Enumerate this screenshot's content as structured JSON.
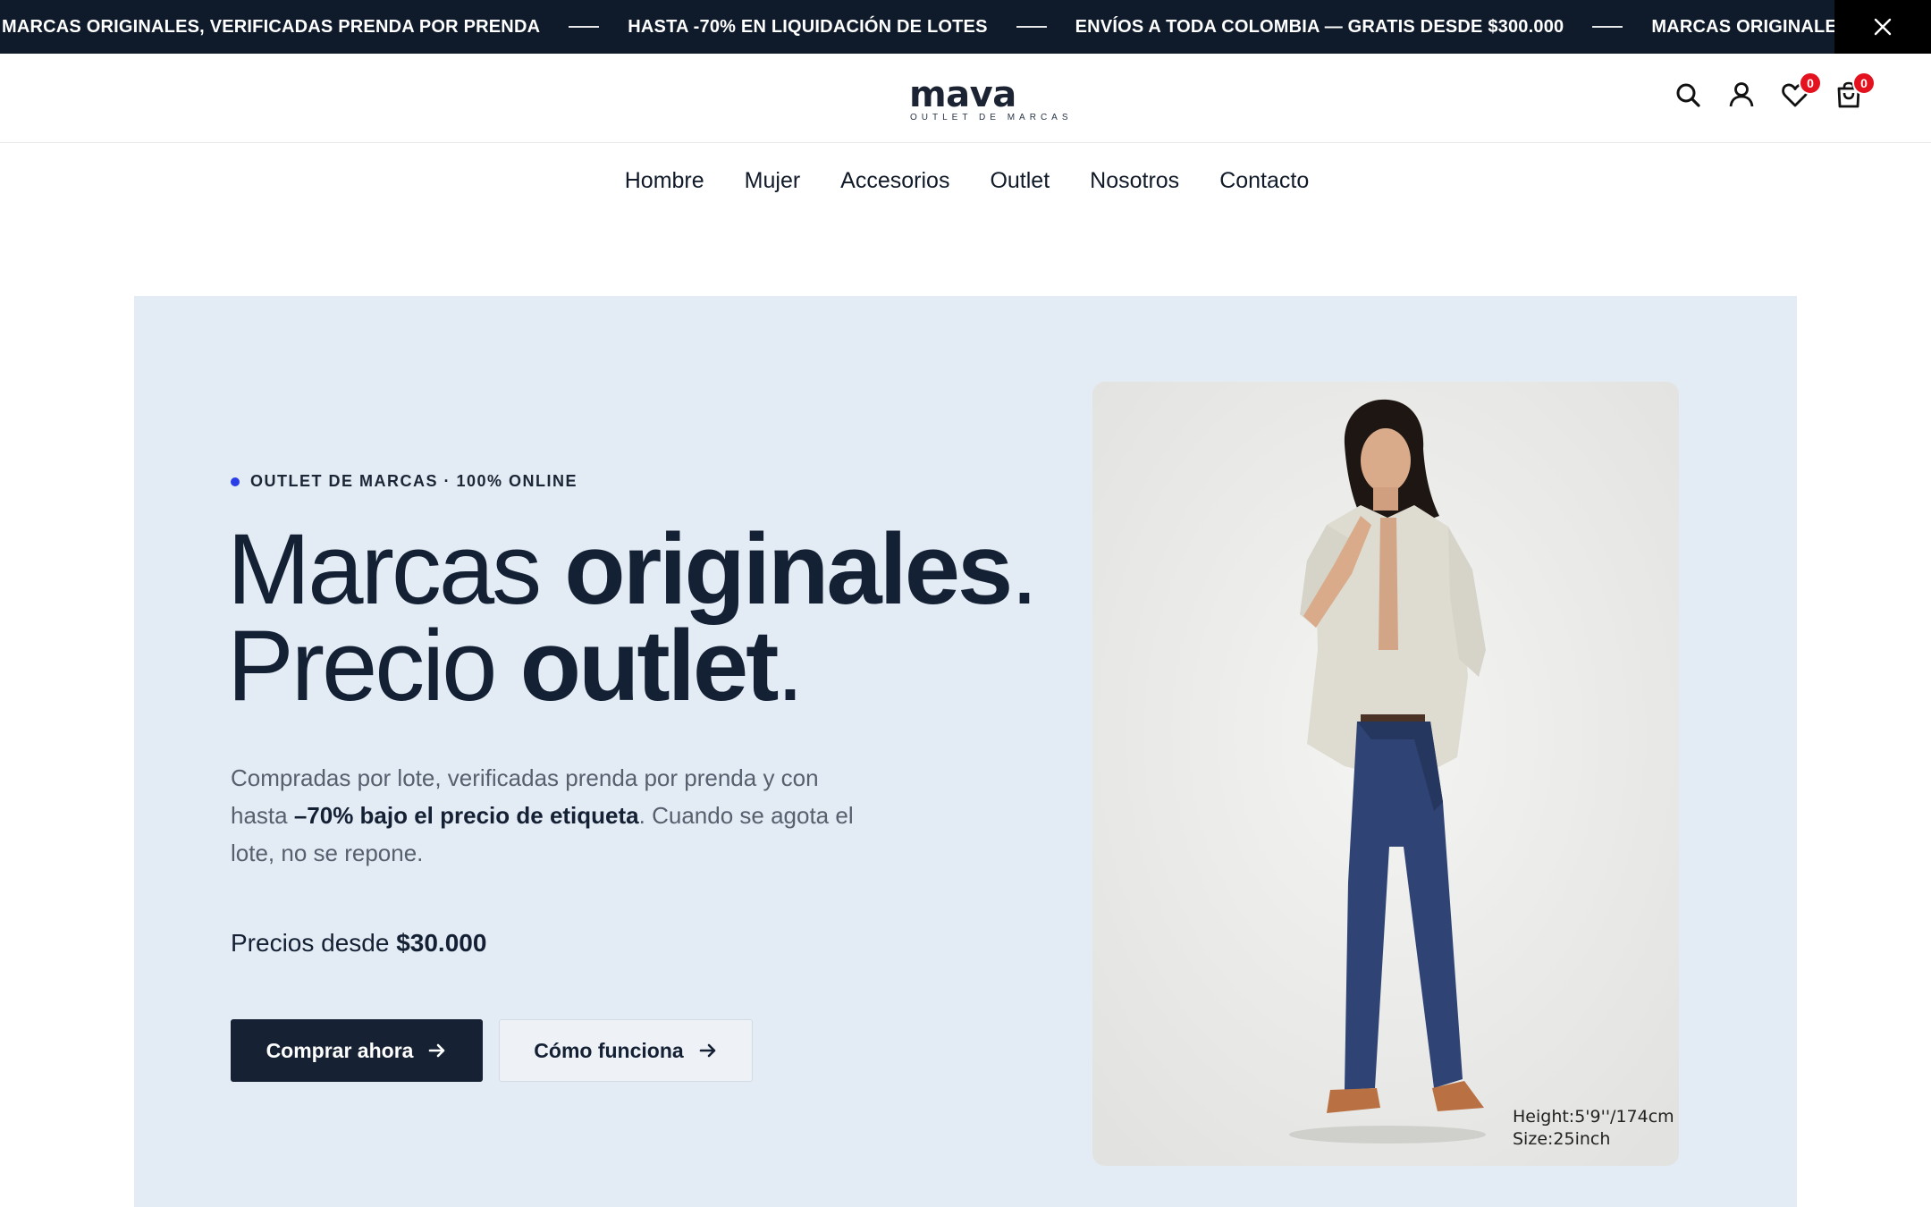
{
  "announcement": {
    "items": [
      "MARCAS ORIGINALES, VERIFICADAS PRENDA POR PRENDA",
      "HASTA -70% EN LIQUIDACIÓN DE LOTES",
      "ENVÍOS A TODA COLOMBIA — GRATIS DESDE $300.000",
      "MARCAS ORIGINALES, VERIFICADAS PRENDA POR PRENDA"
    ],
    "close_icon": "close-icon"
  },
  "header": {
    "logo_word": "mava",
    "logo_tagline": "OUTLET DE MARCAS",
    "icons": [
      "search-icon",
      "user-icon",
      "heart-icon",
      "bag-icon"
    ],
    "wishlist_count": "0",
    "cart_count": "0",
    "badge_color": "#e3121e"
  },
  "nav": {
    "items": [
      "Hombre",
      "Mujer",
      "Accesorios",
      "Outlet",
      "Nosotros",
      "Contacto"
    ]
  },
  "hero": {
    "eyebrow": "OUTLET DE MARCAS · 100% ONLINE",
    "headline_line1_light": "Marcas ",
    "headline_line1_bold": "originales",
    "headline_line1_end": ".",
    "headline_line2_light": "Precio ",
    "headline_line2_bold": "outlet",
    "headline_line2_end": ".",
    "desc_pre": "Compradas por lote, verificadas prenda por prenda y con hasta ",
    "desc_bold": "–70% bajo el precio de etiqueta",
    "desc_post": ". Cuando se agota el lote, no se repone.",
    "price_prefix": "Precios desde ",
    "price_value": "$30.000",
    "primary_button": "Comprar ahora",
    "secondary_button": "Cómo funciona",
    "background_color": "#e3ebf4",
    "accent_color": "#162233"
  },
  "photo": {
    "caption_line1": "Height:5'9''/174cm",
    "caption_line2": "Size:25inch"
  }
}
